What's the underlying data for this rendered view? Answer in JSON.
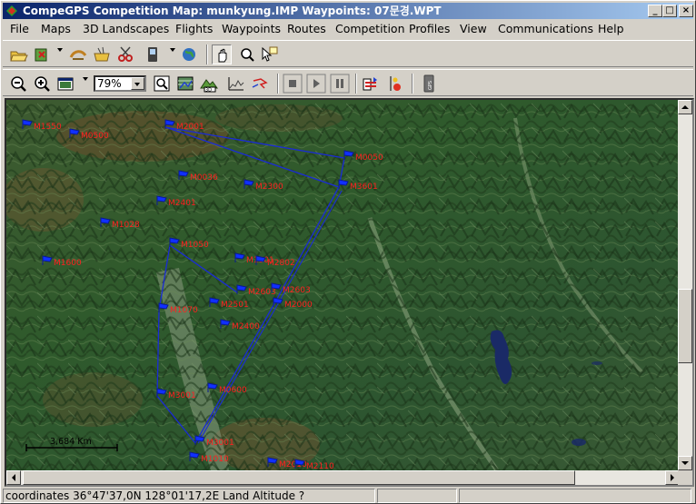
{
  "window": {
    "title": "CompeGPS Competition Map: munkyung.IMP Waypoints:  07문경.WPT",
    "controls": {
      "minimize": "_",
      "maximize": "□",
      "close": "×"
    }
  },
  "menu": [
    "File",
    "Maps",
    "3D Landscapes",
    "Flights",
    "Waypoints",
    "Routes",
    "Competition",
    "Profiles",
    "View",
    "Communications",
    "Help"
  ],
  "toolbar1": {
    "icons": [
      "open-folder-icon",
      "open-map-icon",
      "open-flight-icon",
      "open-waypoints-icon",
      "scissors-icon",
      "gps-device-icon",
      "globe-icon",
      "hand-pan-icon",
      "zoom-area-icon",
      "select-arrow-icon"
    ]
  },
  "toolbar2": {
    "zoom_level": "79%",
    "icons": [
      "zoom-out-icon",
      "zoom-in-icon",
      "fit-map-icon",
      "magnify-icon",
      "map-layers-icon",
      "3d-view-icon",
      "profile-graph-icon",
      "track-icon",
      "stop-icon",
      "play-icon",
      "pause-icon",
      "analyze-icon",
      "palette-icon",
      "gps-icon"
    ]
  },
  "map": {
    "scale_label": "3,684 Km",
    "waypoints": [
      "M1550",
      "M0500",
      "M2001",
      "M0050",
      "M3601",
      "M0036",
      "M2300",
      "M2401",
      "M1028",
      "M1600",
      "M1050",
      "M1001",
      "M2802",
      "M2603",
      "M2501",
      "M2603",
      "M1070",
      "M2000",
      "M2400",
      "M0600",
      "M3001",
      "M3001",
      "M1010",
      "M2010",
      "M2110"
    ],
    "route_color": "#1a2bd6",
    "waypoint_color": "#1030ff",
    "label_color": "#ff2020"
  },
  "status": {
    "coordinates": "coordinates 36°47'37,0N 128°01'17,2E Land Altitude ?"
  }
}
